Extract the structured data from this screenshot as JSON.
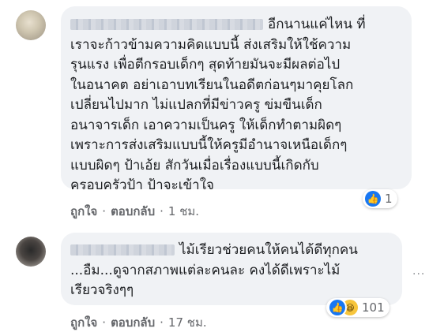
{
  "comments": [
    {
      "text_lines": [
        "อีกนานแค่ไหน ที่",
        "เราจะก้าวข้ามความคิดแบบนี้ ส่งเสริมให้ใช้ความ",
        "รุนแรง เพื่อตีกรอบเด็กๆ สุดท้ายมันจะมีผลต่อไป",
        "ในอนาคต อย่าเอาบทเรียนในอดีตก่อนๆมาคุยโลก",
        "เปลี่ยนไปมาก ไม่แปลกที่มีข่าวครู ข่มขืนเด็ก",
        "อนาจารเด็ก เอาความเป็นครู ให้เด็กทำตามผิดๆ",
        "เพราะการส่งเสริมแบบนี้ให้ครูมีอำนาจเหนือเด็กๆ",
        "แบบผิดๆ ป้าเอ้ย สักวันเมื่อเรื่องแบบนี้เกิดกับ",
        "ครอบครัวป้า ป้าจะเข้าใจ"
      ],
      "reaction_count": "1",
      "like_label": "ถูกใจ",
      "reply_label": "ตอบกลับ",
      "time": "1 ชม."
    },
    {
      "text_lines": [
        "ไม้เรียวช่วยคนให้คนได้ดีทุกคน",
        "...อืม...ดูจากสภาพแต่ละคนละ คงได้ดีเพราะไม้",
        "เรียวจริงๆๆ"
      ],
      "reaction_count": "101",
      "like_label": "ถูกใจ",
      "reply_label": "ตอบกลับ",
      "time": "17 ชม."
    }
  ],
  "icons": {
    "like": "thumbs-up-icon",
    "haha": "laughing-face-icon",
    "more": "more-options-icon"
  },
  "colors": {
    "bubble": "#f0f2f5",
    "like_blue": "#1877f2",
    "meta_gray": "#65676b"
  }
}
